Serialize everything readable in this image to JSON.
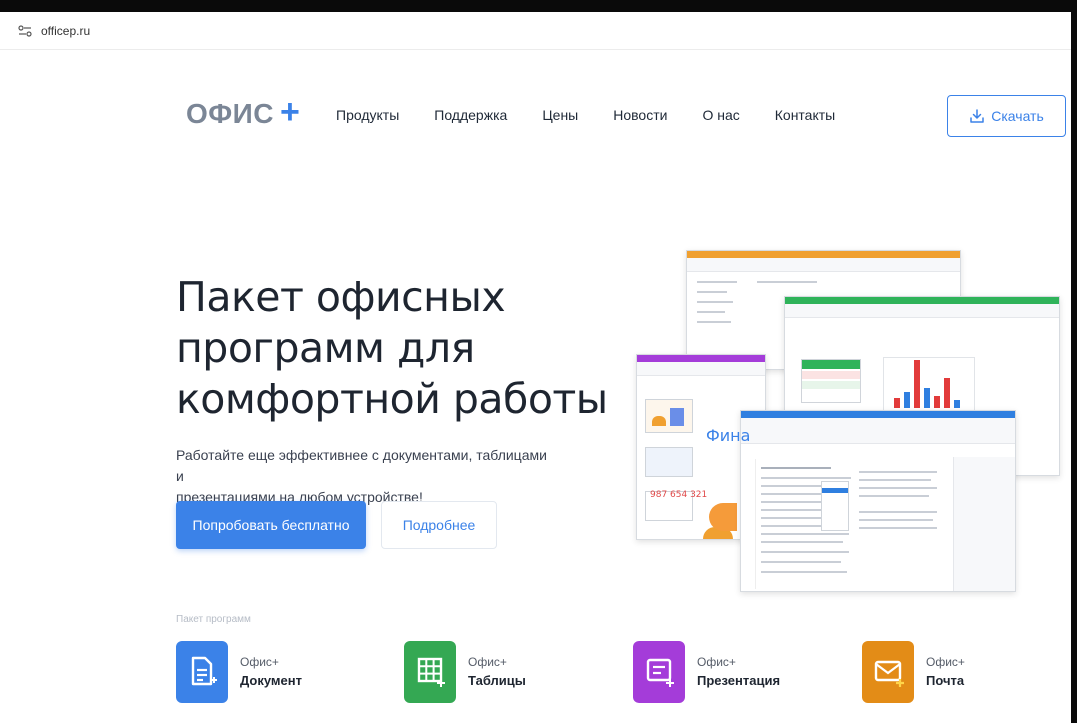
{
  "browser": {
    "url": "officep.ru"
  },
  "header": {
    "logo_text": "ОФИС",
    "logo_plus": "+",
    "nav": [
      "Продукты",
      "Поддержка",
      "Цены",
      "Новости",
      "О нас",
      "Контакты"
    ],
    "download_label": "Скачать"
  },
  "hero": {
    "title_line1": "Пакет офисных",
    "title_line2": "программ для",
    "title_line3": "комфортной работы",
    "subtitle_line1": "Работайте еще эффективнее с документами, таблицами и",
    "subtitle_line2": "презентациями на любом устройстве!",
    "try_free_label": "Попробовать бесплатно",
    "more_label": "Подробнее"
  },
  "collage": {
    "presentation_heading": "Фина",
    "presentation_number": "987 654 321"
  },
  "products_section": {
    "label": "Пакет программ",
    "items": [
      {
        "brand": "Офис+",
        "name": "Документ",
        "color": "#3b82e8",
        "icon": "document-icon"
      },
      {
        "brand": "Офис+",
        "name": "Таблицы",
        "color": "#34a853",
        "icon": "spreadsheet-icon"
      },
      {
        "brand": "Офис+",
        "name": "Презентация",
        "color": "#a43cd9",
        "icon": "presentation-icon"
      },
      {
        "brand": "Офис+",
        "name": "Почта",
        "color": "#e38c17",
        "icon": "mail-icon"
      }
    ]
  },
  "colors": {
    "accent": "#3b82e8",
    "logo_gray": "#7b8696",
    "text_dark": "#1e2530"
  }
}
